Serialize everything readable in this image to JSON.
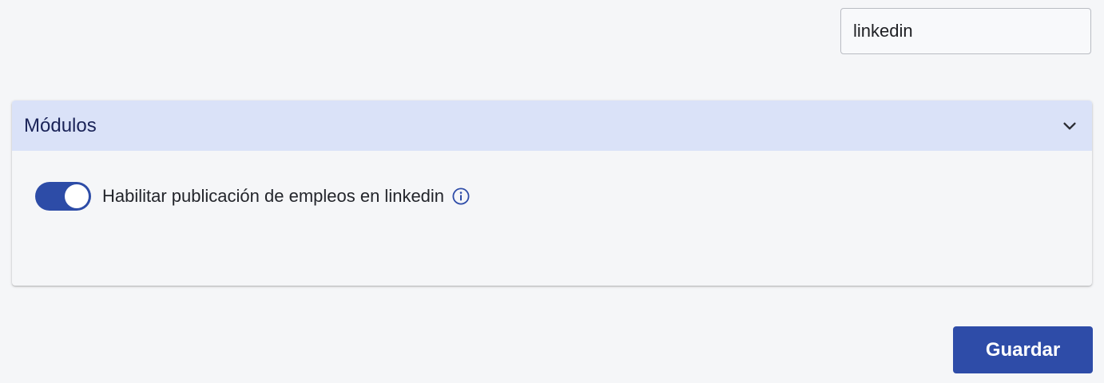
{
  "search": {
    "value": "linkedin"
  },
  "modules_panel": {
    "title": "Módulos",
    "expanded": true,
    "toggle_icon": "chevron-down-icon",
    "settings": [
      {
        "label": "Habilitar publicación de empleos en linkedin",
        "enabled": true,
        "info_icon": "info-icon"
      }
    ]
  },
  "actions": {
    "save_label": "Guardar"
  },
  "colors": {
    "background": "#f5f6f8",
    "header_background": "#dae2f8",
    "accent": "#2e4ca8",
    "title_text": "#1a2358"
  }
}
